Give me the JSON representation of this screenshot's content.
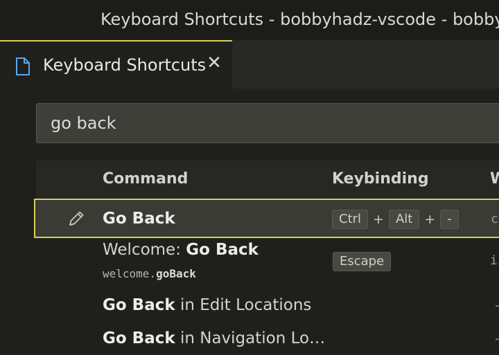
{
  "window": {
    "title": "Keyboard Shortcuts - bobbyhadz-vscode - bobbyhadz"
  },
  "tab": {
    "label": "Keyboard Shortcuts",
    "icon": "file-icon",
    "close_glyph": "✕"
  },
  "search": {
    "value": "go back"
  },
  "table": {
    "headers": {
      "command": "Command",
      "keybinding": "Keybinding",
      "when": "W"
    },
    "rows": [
      {
        "command_bold": "Go Back",
        "keys": [
          "Ctrl",
          "Alt",
          "-"
        ],
        "plus": "+",
        "when": "c",
        "selected": true
      },
      {
        "command_prefix": "Welcome: ",
        "command_bold": "Go Back",
        "command_id_prefix": "welcome.",
        "command_id_bold": "goBack",
        "keys": [
          "Escape"
        ],
        "when": "i"
      },
      {
        "command_bold": "Go Back",
        "command_suffix": " in Edit Locations",
        "when": "-"
      },
      {
        "command_bold": "Go Back",
        "command_suffix": " in Navigation Lo…",
        "when": "-"
      }
    ]
  },
  "colors": {
    "accent_border": "#d7d05a",
    "background": "#1f201d",
    "selected_row": "#3a3b35"
  }
}
